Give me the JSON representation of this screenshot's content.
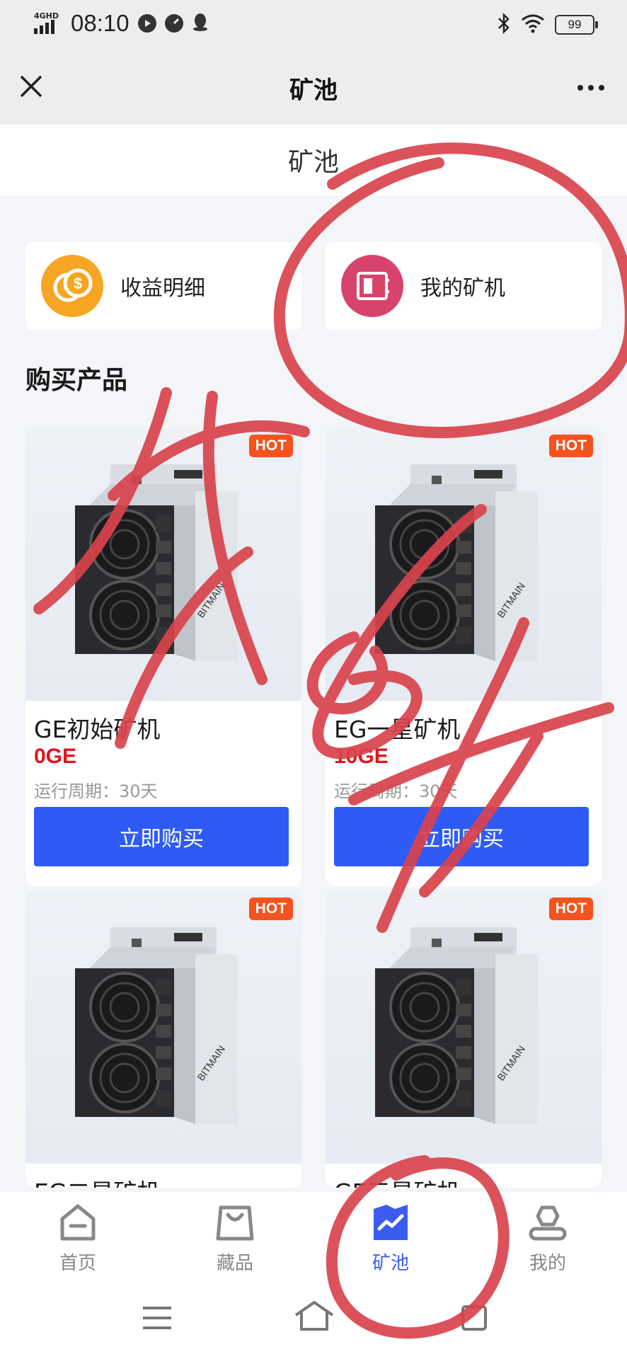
{
  "status_bar": {
    "network": "4GHD",
    "time": "08:10",
    "battery": "99"
  },
  "titlebar": {
    "title": "矿池"
  },
  "page": {
    "header": "矿池",
    "quick_entries": [
      {
        "label": "收益明细",
        "icon": "coin-icon",
        "color": "#f7a623"
      },
      {
        "label": "我的矿机",
        "icon": "safe-icon",
        "color": "#d8436b"
      }
    ],
    "section_title": "购买产品",
    "hot_badge": "HOT",
    "buy_label": "立即购买",
    "period_label": "运行周期：30天",
    "products": [
      {
        "name": "GE初始矿机",
        "price": "0GE",
        "period": "运行周期：30天",
        "button": "立即购买"
      },
      {
        "name": "EG一星矿机",
        "price": "10GE",
        "period": "运行周期：30天",
        "button": "立即购买"
      },
      {
        "name": "EG二星矿机"
      },
      {
        "name": "GE三星矿机"
      }
    ]
  },
  "tabbar": {
    "items": [
      {
        "label": "首页",
        "icon": "home-icon"
      },
      {
        "label": "藏品",
        "icon": "bag-icon"
      },
      {
        "label": "矿池",
        "icon": "chart-icon",
        "active": true
      },
      {
        "label": "我的",
        "icon": "user-icon"
      }
    ]
  },
  "colors": {
    "accent": "#2e5bf6",
    "price": "#e3141d",
    "hot": "#f5521e",
    "scribble": "#d9434c"
  }
}
